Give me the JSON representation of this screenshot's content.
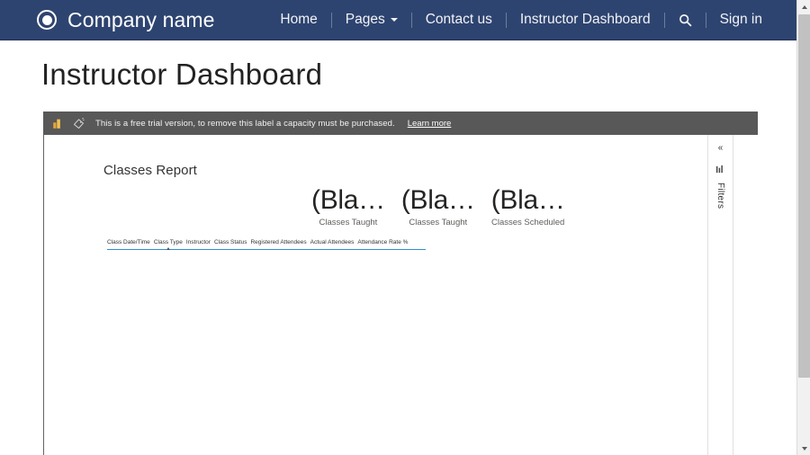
{
  "navbar": {
    "brand": "Company name",
    "logo_icon": "circle-target-icon",
    "items": [
      {
        "label": "Home",
        "type": "link"
      },
      {
        "label": "Pages",
        "type": "dropdown"
      },
      {
        "label": "Contact us",
        "type": "link"
      },
      {
        "label": "Instructor Dashboard",
        "type": "link"
      },
      {
        "label": "Sign in",
        "type": "link"
      }
    ],
    "search_icon": "search-icon"
  },
  "page": {
    "title": "Instructor Dashboard"
  },
  "trial_banner": {
    "product_icon": "power-bi-icon",
    "tag_icon": "label-tag-icon",
    "message": "This is a free trial version, to remove this label a capacity must be purchased.",
    "link_label": "Learn more"
  },
  "report": {
    "heading": "Classes Report",
    "kpis": [
      {
        "value": "(Bla…",
        "label": "Classes Taught"
      },
      {
        "value": "(Bla…",
        "label": "Classes Taught"
      },
      {
        "value": "(Bla…",
        "label": "Classes Scheduled"
      }
    ],
    "table": {
      "columns": [
        "Class Date/Time",
        "Class Type",
        "Instructor",
        "Class Status",
        "Registered Attendees",
        "Actual Attendees",
        "Attendance Rate %"
      ],
      "sorted_column": "Class Type",
      "rows": []
    },
    "filters_pane": {
      "expand_glyph": "«",
      "filter_icon": "filter-icon",
      "label": "Filters"
    }
  },
  "colors": {
    "navbar_bg": "#2e4470",
    "banner_bg": "#585858",
    "table_underline": "#2f8fd4",
    "page_text": "#222222"
  }
}
